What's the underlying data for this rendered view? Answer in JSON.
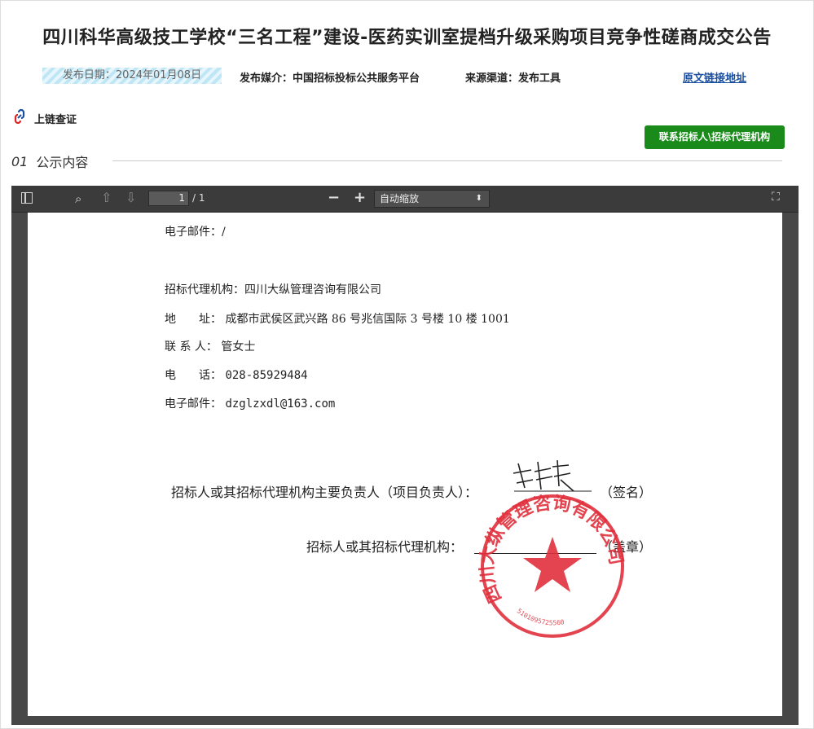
{
  "title": "四川科华高级技工学校“三名工程”建设-医药实训室提档升级采购项目竞争性磋商成交公告",
  "meta": {
    "date": "发布日期：2024年01月08日",
    "media": "发布媒介：中国招标投标公共服务平台",
    "source": "来源渠道：发布工具",
    "link": "原文链接地址"
  },
  "chain_label": "上链查证",
  "contact_button": "联系招标人\\招标代理机构",
  "section": {
    "num": "01",
    "label": "公示内容"
  },
  "viewer": {
    "page_input": "1",
    "page_total": "/ 1",
    "zoom": "自动缩放",
    "icons": [
      "sidebar-toggle-icon",
      "search-icon",
      "arrow-up-icon",
      "arrow-down-icon",
      "zoom-out-icon",
      "zoom-in-icon",
      "fullscreen-icon"
    ]
  },
  "document": {
    "email1": "电子邮件：/",
    "agency": "招标代理机构：四川大纵管理咨询有限公司",
    "address_label": "地　　址：",
    "address_value": "成都市武侯区武兴路 86 号兆信国际 3 号楼 10 楼 1001",
    "contact_label": "联 系 人：",
    "contact_value": "管女士",
    "phone_label": "电　　话：",
    "phone_value": "028-85929484",
    "email2_label": "电子邮件：",
    "email2_value": "dzglzxdl@163.com",
    "sign_line": "招标人或其招标代理机构主要负责人（项目负责人）：",
    "sign_suffix": "（签名）",
    "seal_line": "招标人或其招标代理机构：",
    "seal_suffix": "（盖章）",
    "stamp_text": "四川大纵管理咨询有限公司",
    "stamp_number": "5101095725560",
    "stamp_color": "#e0303c"
  }
}
